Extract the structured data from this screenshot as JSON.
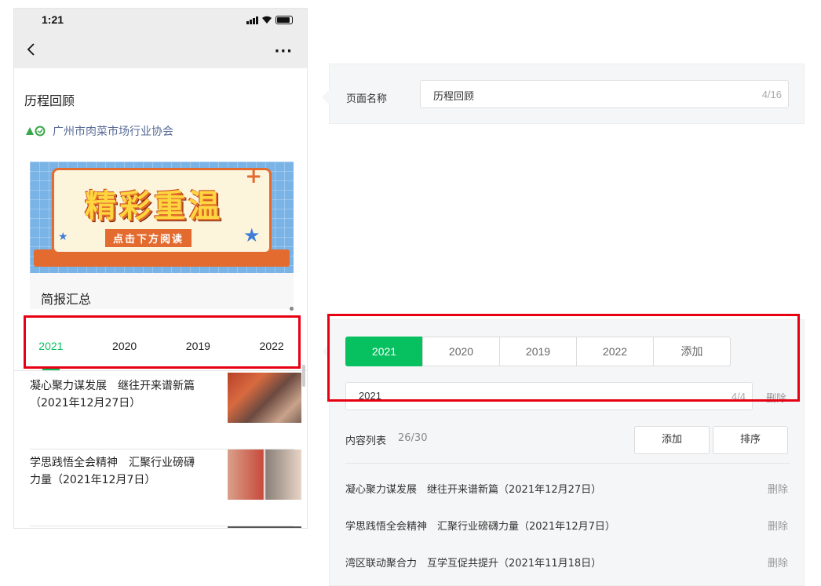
{
  "phone": {
    "status_time": "1:21",
    "more_label": "···",
    "page_title": "历程回顾",
    "org_name": "广州市肉菜市场行业协会",
    "banner": {
      "title": "精彩重温",
      "subtitle": "点击下方阅读"
    },
    "section_title": "简报汇总",
    "tabs": [
      {
        "label": "2021",
        "active": true
      },
      {
        "label": "2020",
        "active": false
      },
      {
        "label": "2019",
        "active": false
      },
      {
        "label": "2022",
        "active": false
      }
    ],
    "articles": [
      {
        "title": "凝心聚力谋发展　继往开来谱新篇（2021年12月27日）"
      },
      {
        "title": "学思践悟全会精神　汇聚行业磅礴力量（2021年12月7日）"
      }
    ]
  },
  "editor": {
    "page_name_label": "页面名称",
    "page_name_value": "历程回顾",
    "page_name_count": "4/16",
    "year_tabs": [
      {
        "label": "2021",
        "active": true
      },
      {
        "label": "2020",
        "active": false
      },
      {
        "label": "2019",
        "active": false
      },
      {
        "label": "2022",
        "active": false
      }
    ],
    "add_tab_label": "添加",
    "year_value": "2021",
    "year_count": "4/4",
    "delete_label": "删除",
    "content_list_label": "内容列表",
    "content_list_count": "26/30",
    "add_button": "添加",
    "sort_button": "排序",
    "items": [
      {
        "title": "凝心聚力谋发展　继往开来谱新篇（2021年12月27日）",
        "delete": "删除"
      },
      {
        "title": "学思践悟全会精神　汇聚行业磅礴力量（2021年12月7日）",
        "delete": "删除"
      },
      {
        "title": "湾区联动聚合力　互学互促共提升（2021年11月18日）",
        "delete": "删除"
      }
    ]
  },
  "colors": {
    "accent": "#07c160",
    "highlight": "#e60012",
    "link": "#576b95"
  }
}
